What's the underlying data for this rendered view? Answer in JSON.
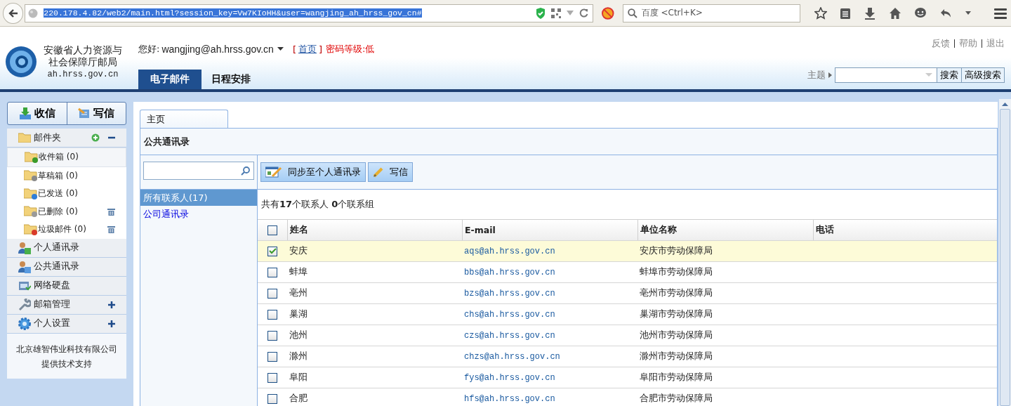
{
  "browser": {
    "url": "220.178.4.82/web2/main.html?session_key=Vw7KIoHH&user=wangjing_ah_hrss_gov_cn#",
    "search_placeholder": "百度 <Ctrl+K>"
  },
  "header": {
    "org_name": "安徽省人力资源与社会保障厅邮局",
    "domain": "ah.hrss.gov.cn",
    "greeting": "您好:",
    "user": "wangjing@ah.hrss.gov.cn",
    "home_open": "[",
    "home_link": "首页",
    "home_close": "]",
    "password_level": "密码等级:低",
    "links": [
      "反馈",
      "帮助",
      "退出"
    ],
    "tabs": [
      {
        "label": "电子邮件",
        "selected": true
      },
      {
        "label": "日程安排",
        "selected": false
      }
    ],
    "search_label": "主题",
    "search_buttons": [
      "搜索",
      "高级搜索"
    ]
  },
  "sidebar": {
    "actions": [
      {
        "label": "收信",
        "kind": "receive"
      },
      {
        "label": "写信",
        "kind": "compose"
      }
    ],
    "sections": [
      {
        "label": "邮件夹",
        "kind": "folders",
        "expanded": true,
        "folders": [
          {
            "label": "收件箱 (0)",
            "kind": "inbox",
            "selected": true,
            "trash": false
          },
          {
            "label": "草稿箱 (0)",
            "kind": "drafts",
            "selected": false,
            "trash": false
          },
          {
            "label": "已发送 (0)",
            "kind": "sent",
            "selected": false,
            "trash": false
          },
          {
            "label": "已删除 (0)",
            "kind": "deleted",
            "selected": false,
            "trash": true
          },
          {
            "label": "垃圾邮件 (0)",
            "kind": "spam",
            "selected": false,
            "trash": true
          }
        ]
      },
      {
        "label": "个人通讯录",
        "kind": "contacts"
      },
      {
        "label": "公共通讯录",
        "kind": "public"
      },
      {
        "label": "网络硬盘",
        "kind": "disk"
      },
      {
        "label": "邮箱管理",
        "kind": "manage",
        "expanded": false
      },
      {
        "label": "个人设置",
        "kind": "settings",
        "expanded": false
      }
    ],
    "footer": [
      "北京雄智伟业科技有限公司",
      "提供技术支持"
    ]
  },
  "main": {
    "tabs": [
      {
        "label": "主页",
        "selected": true
      }
    ],
    "title": "公共通讯录",
    "groups": [
      {
        "label": "所有联系人(17)",
        "selected": true
      },
      {
        "label": "公司通讯录",
        "selected": false
      }
    ],
    "toolbar": [
      {
        "label": "同步至个人通讯录",
        "kind": "sync"
      },
      {
        "label": "写信",
        "kind": "compose"
      }
    ],
    "summary": "共有**17**个联系人 **0**个联系组",
    "table": {
      "all_checked": false,
      "columns": [
        "姓名",
        "E-mail",
        "单位名称",
        "电话"
      ],
      "rows": [
        {
          "checked": true,
          "name": "安庆",
          "email": "aqs@ah.hrss.gov.cn",
          "unit": "安庆市劳动保障局"
        },
        {
          "checked": false,
          "name": "蚌埠",
          "email": "bbs@ah.hrss.gov.cn",
          "unit": "蚌埠市劳动保障局"
        },
        {
          "checked": false,
          "name": "亳州",
          "email": "bzs@ah.hrss.gov.cn",
          "unit": "亳州市劳动保障局"
        },
        {
          "checked": false,
          "name": "巢湖",
          "email": "chs@ah.hrss.gov.cn",
          "unit": "巢湖市劳动保障局"
        },
        {
          "checked": false,
          "name": "池州",
          "email": "czs@ah.hrss.gov.cn",
          "unit": "池州市劳动保障局"
        },
        {
          "checked": false,
          "name": "滁州",
          "email": "chzs@ah.hrss.gov.cn",
          "unit": "滁州市劳动保障局"
        },
        {
          "checked": false,
          "name": "阜阳",
          "email": "fys@ah.hrss.gov.cn",
          "unit": "阜阳市劳动保障局"
        },
        {
          "checked": false,
          "name": "合肥",
          "email": "hfs@ah.hrss.gov.cn",
          "unit": "合肥市劳动保障局"
        }
      ]
    }
  }
}
